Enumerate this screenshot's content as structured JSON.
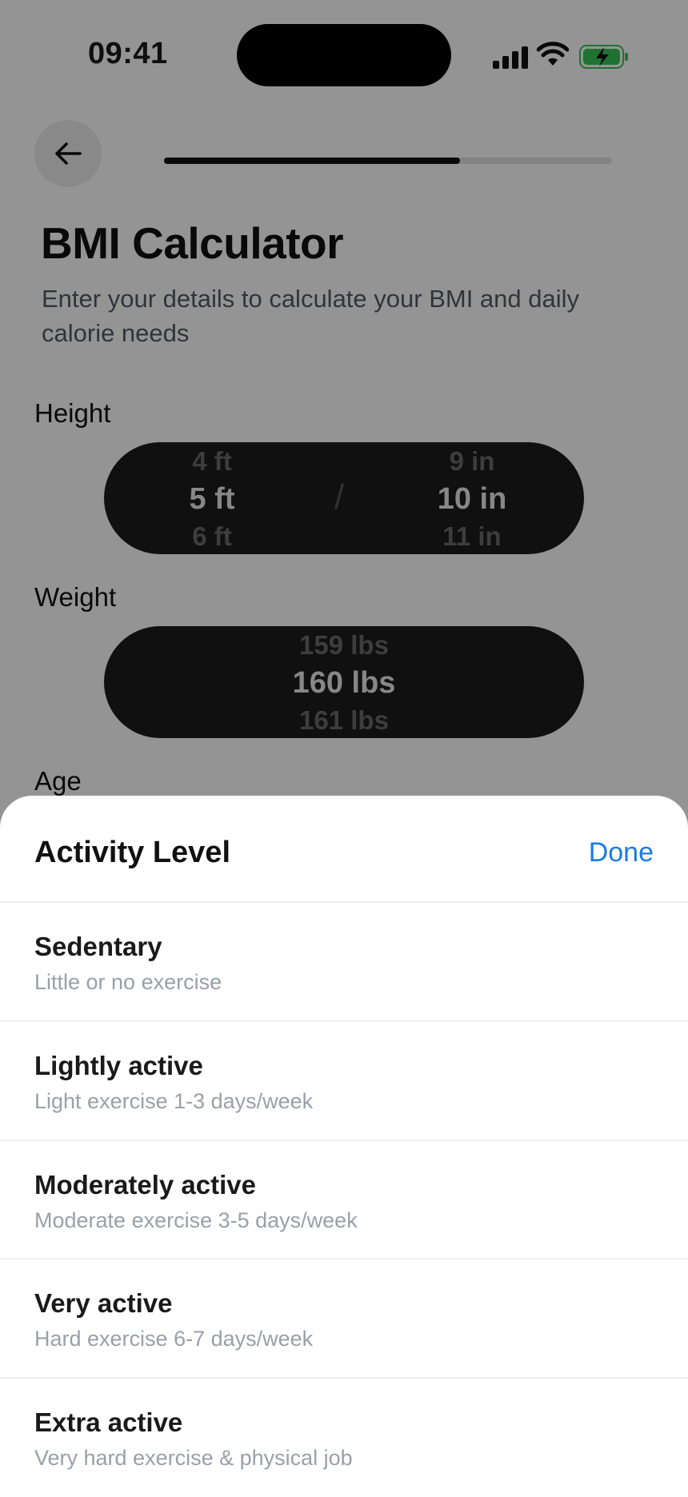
{
  "status_bar": {
    "time": "09:41"
  },
  "header": {
    "progress": 0.66
  },
  "page": {
    "title": "BMI Calculator",
    "subtitle": "Enter your details to calculate your BMI and daily calorie needs"
  },
  "height": {
    "label": "Height",
    "feet": {
      "prev": "4 ft",
      "selected": "5 ft",
      "next": "6 ft"
    },
    "separator": "/",
    "inches": {
      "prev": "9 in",
      "selected": "10 in",
      "next": "11 in"
    }
  },
  "weight": {
    "label": "Weight",
    "prev": "159 lbs",
    "selected": "160 lbs",
    "next": "161 lbs"
  },
  "age": {
    "label": "Age"
  },
  "sheet": {
    "title": "Activity Level",
    "done_label": "Done",
    "options": [
      {
        "title": "Sedentary",
        "subtitle": "Little or no exercise"
      },
      {
        "title": "Lightly active",
        "subtitle": "Light exercise 1-3 days/week"
      },
      {
        "title": "Moderately active",
        "subtitle": "Moderate exercise 3-5 days/week"
      },
      {
        "title": "Very active",
        "subtitle": "Hard exercise 6-7 days/week"
      },
      {
        "title": "Extra active",
        "subtitle": "Very hard exercise & physical job"
      }
    ]
  },
  "colors": {
    "accent": "#1a7be6",
    "battery": "#34c759",
    "picker_bg": "#1c1c1c"
  },
  "icons": [
    "back-arrow-icon",
    "signal-icon",
    "wifi-icon",
    "battery-charging-icon"
  ]
}
